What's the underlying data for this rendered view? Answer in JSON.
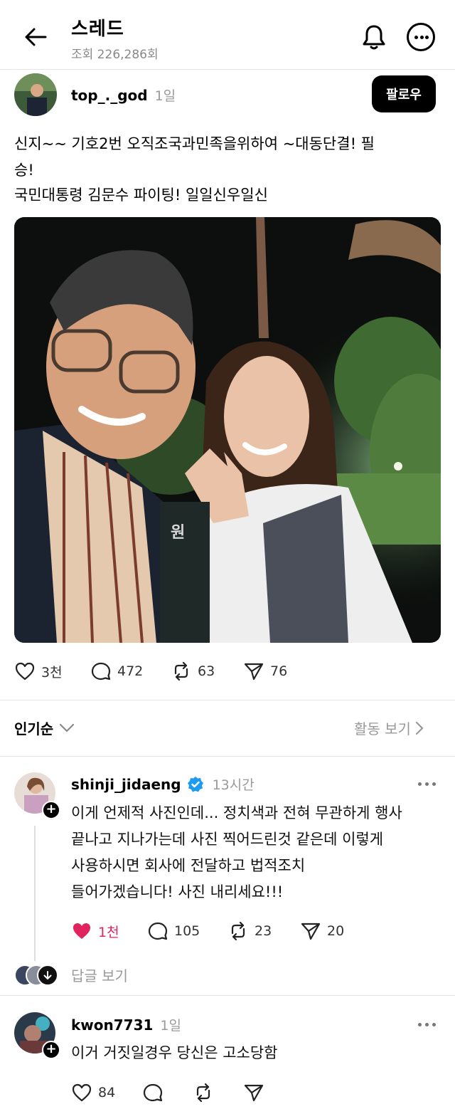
{
  "header": {
    "title": "스레드",
    "views": "조회 226,286회"
  },
  "post": {
    "username": "top_._god",
    "time": "1일",
    "follow_label": "팔로우",
    "text_line1": "신지~~ 기호2번  오직조국과민족을위하여 ~대동단결! 필",
    "text_line2": "승!",
    "text_line3": "국민대통령 김문수 파이팅! 일일신우일신",
    "photo_caption_mark": "원",
    "stats": {
      "likes": "3천",
      "comments": "472",
      "reposts": "63",
      "shares": "76"
    }
  },
  "sort_bar": {
    "sort_label": "인기순",
    "activity_label": "활동 보기"
  },
  "comments": [
    {
      "username": "shinji_jidaeng",
      "verified": true,
      "time": "13시간",
      "line1": "이게 언제적 사진인데... 정치색과 전혀 무관하게 행사",
      "line2": "끝나고 지나가는데 사진 찍어드린것 같은데 이렇게",
      "line3": "사용하시면 회사에 전달하고 법적조치",
      "line4": "들어가겠습니다! 사진 내리세요!!!",
      "stats": {
        "likes": "1천",
        "comments": "105",
        "reposts": "23",
        "shares": "20"
      },
      "replies_label": "답글 보기"
    },
    {
      "username": "kwon7731",
      "time": "1일",
      "line1": "이거 거짓일경우 당신은 고소당함",
      "stats": {
        "likes": "84"
      }
    }
  ],
  "colors": {
    "like_red": "#e0245e",
    "verified_blue": "#1d9bf0",
    "follow_bg": "#000000"
  }
}
